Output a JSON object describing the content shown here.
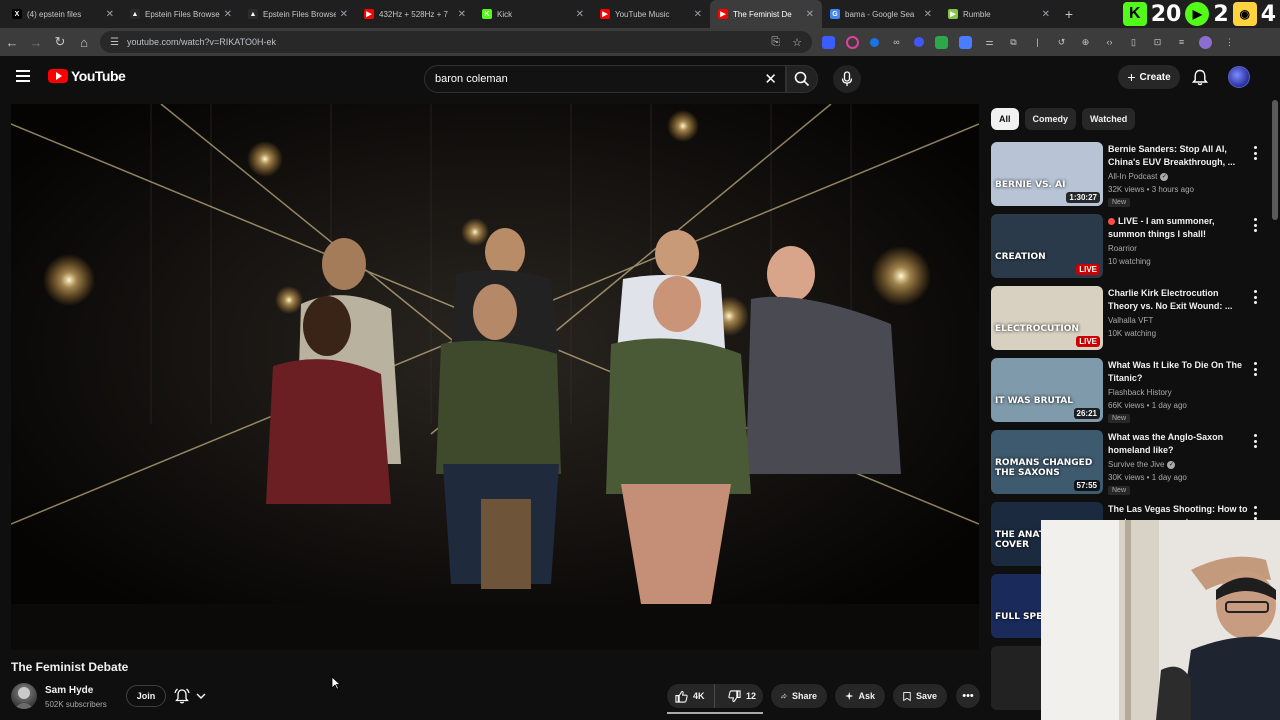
{
  "browser": {
    "tabs": [
      {
        "title": "(4) epstein files",
        "color": "#000000",
        "glyph": "X",
        "close": "✕"
      },
      {
        "title": "Epstein Files Browser",
        "color": "#2b2b2b",
        "glyph": "▲",
        "close": "✕"
      },
      {
        "title": "Epstein Files Browser",
        "color": "#2b2b2b",
        "glyph": "▲",
        "close": "✕"
      },
      {
        "title": "432Hz + 528Hz + 7",
        "color": "#ff0000",
        "glyph": "▶",
        "close": "✕"
      },
      {
        "title": "Kick",
        "color": "#53fc18",
        "glyph": "K",
        "close": "✕"
      },
      {
        "title": "YouTube Music",
        "color": "#ff0000",
        "glyph": "▶",
        "close": "✕"
      },
      {
        "title": "The Feminist De",
        "color": "#ff0000",
        "glyph": "▶",
        "close": "✕",
        "active": true
      },
      {
        "title": "bama - Google Sea",
        "color": "#4285f4",
        "glyph": "G",
        "close": "✕"
      },
      {
        "title": "Rumble",
        "color": "#85c742",
        "glyph": "▶",
        "close": "✕"
      }
    ],
    "new_tab": "+",
    "overlay": {
      "k_label": "K",
      "count1": "20",
      "count2": "2",
      "count3": "4"
    },
    "url": "youtube.com/watch?v=RIKATO0H-ek"
  },
  "header": {
    "logo_text": "YouTube",
    "search_value": "baron coleman",
    "search_clear": "✕",
    "create_label": "Create",
    "create_plus": "+"
  },
  "video": {
    "title": "The Feminist Debate",
    "channel": "Sam Hyde",
    "subscribers": "502K subscribers",
    "join_label": "Join",
    "likes": "4K",
    "dislikes": "12",
    "share_label": "Share",
    "ask_label": "Ask",
    "save_label": "Save",
    "more_label": "•••"
  },
  "sidebar": {
    "chips": [
      "All",
      "Comedy",
      "Watched"
    ],
    "recommendations": [
      {
        "title": "Bernie Sanders: Stop All AI, China's EUV Breakthrough, ...",
        "channel": "All-In Podcast",
        "verified": true,
        "meta": "32K views • 3 hours ago",
        "badge": "New",
        "duration": "1:30:27",
        "thumb_text": "BERNIE VS. AI",
        "thumb_bg": "#b8c4d6"
      },
      {
        "title": "LIVE - I am summoner, summon things I shall!",
        "channel": "Roarrior",
        "live_title": true,
        "meta": "10 watching",
        "live": "LIVE",
        "thumb_text": "CREATION",
        "thumb_bg": "#2a3a4a"
      },
      {
        "title": "Charlie Kirk Electrocution Theory vs. No Exit Wound: ...",
        "channel": "Valhalla VFT",
        "meta": "10K watching",
        "live": "LIVE",
        "thumb_text": "ELECTROCUTION",
        "thumb_bg": "#d8d0c0"
      },
      {
        "title": "What Was It Like To Die On The Titanic?",
        "channel": "Flashback History",
        "meta": "66K views • 1 day ago",
        "badge": "New",
        "duration": "26:21",
        "thumb_text": "IT WAS BRUTAL",
        "thumb_bg": "#7f9aaa"
      },
      {
        "title": "What was the Anglo-Saxon homeland like?",
        "channel": "Survive the Jive",
        "verified": true,
        "meta": "30K views • 1 day ago",
        "badge": "New",
        "duration": "57:55",
        "thumb_text": "ROMANS CHANGED THE SAXONS",
        "thumb_bg": "#3e5a6e"
      },
      {
        "title": "The Las Vegas Shooting: How to spot a government coverup ...",
        "channel": "",
        "meta": "",
        "thumb_text": "THE ANATOMY OF A COVER",
        "thumb_bg": "#1c2a40"
      },
      {
        "title": "",
        "channel": "",
        "meta": "",
        "thumb_text": "FULL SPEED",
        "thumb_bg": "#1a2a5a"
      },
      {
        "title": "",
        "channel": "",
        "meta": "",
        "thumb_text": "",
        "thumb_bg": "#222222"
      }
    ]
  },
  "colors": {
    "accent_red": "#ff0000",
    "background": "#0f0f0f"
  }
}
